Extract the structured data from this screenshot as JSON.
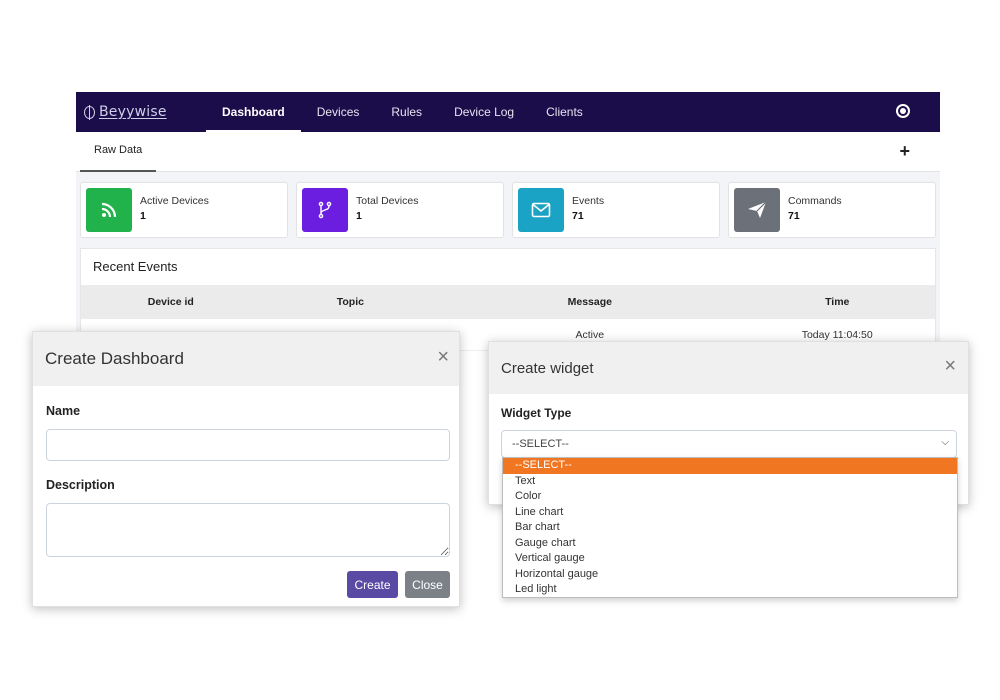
{
  "app": {
    "brand": "Beyywise"
  },
  "nav": {
    "items": [
      {
        "label": "Dashboard",
        "active": true
      },
      {
        "label": "Devices"
      },
      {
        "label": "Rules"
      },
      {
        "label": "Device Log"
      },
      {
        "label": "Clients"
      }
    ],
    "user_icon": "user-circle-icon"
  },
  "tabs": {
    "active": "Raw Data",
    "add_icon": "plus-icon"
  },
  "stats": [
    {
      "label": "Active Devices",
      "value": "1",
      "color": "#22b24c",
      "icon": "rss-icon"
    },
    {
      "label": "Total Devices",
      "value": "1",
      "color": "#6b1ee0",
      "icon": "fork-icon"
    },
    {
      "label": "Events",
      "value": "71",
      "color": "#1aa3c4",
      "icon": "envelope-icon"
    },
    {
      "label": "Commands",
      "value": "71",
      "color": "#6c7078",
      "icon": "paper-plane-icon"
    }
  ],
  "events": {
    "title": "Recent Events",
    "columns": [
      "Device id",
      "Topic",
      "Message",
      "Time"
    ],
    "rows": [
      {
        "device": "",
        "topic": "",
        "message": "Active",
        "time": "Today 11:04:50"
      }
    ]
  },
  "create_dashboard": {
    "title": "Create Dashboard",
    "close": "×",
    "name_label": "Name",
    "name_value": "",
    "description_label": "Description",
    "description_value": "",
    "create_label": "Create",
    "close_label": "Close",
    "colors": {
      "create": "#5a4aa3",
      "close": "#7c8188"
    }
  },
  "create_widget": {
    "title": "Create widget",
    "close": "×",
    "type_label": "Widget Type",
    "selected": "--SELECT--",
    "options": [
      "--SELECT--",
      "Text",
      "Color",
      "Line chart",
      "Bar chart",
      "Gauge chart",
      "Vertical gauge",
      "Horizontal gauge",
      "Led light"
    ],
    "highlight_color": "#f07622"
  }
}
